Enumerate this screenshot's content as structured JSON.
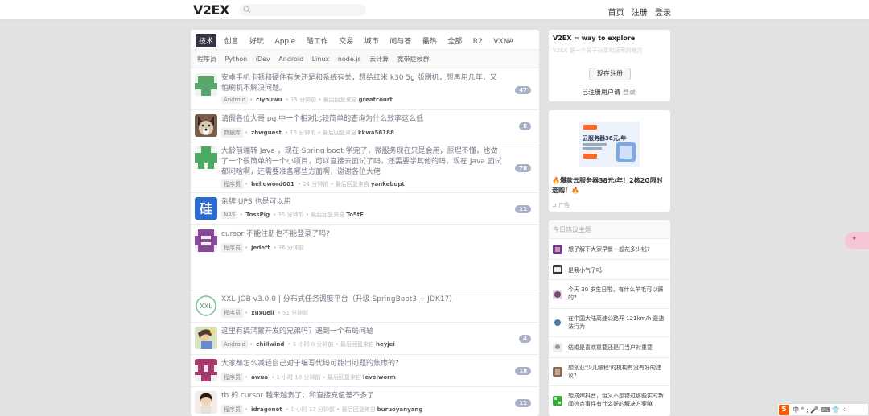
{
  "header": {
    "logo": "V2EX",
    "nav": [
      "首页",
      "注册",
      "登录"
    ]
  },
  "tabs": [
    "技术",
    "创意",
    "好玩",
    "Apple",
    "酷工作",
    "交易",
    "城市",
    "问与答",
    "最热",
    "全部",
    "R2",
    "VXNA"
  ],
  "active_tab": "技术",
  "subtabs": [
    "程序员",
    "Python",
    "iDev",
    "Android",
    "Linux",
    "node.js",
    "云计算",
    "宽带症候群"
  ],
  "topics": [
    {
      "title": "安卓手机卡顿和硬件有关还是和系统有关，想给红米 k30 5g 版刷机，想再用几年，又怕刷机不解决问题。",
      "node": "Android",
      "user": "ciyouwu",
      "time": "15 分钟前",
      "last_label": "最后回复来自",
      "last": "greatcourt",
      "count": "47"
    },
    {
      "title": "请假各位大哥 pg 中一个相对比较简单的查询为什么效率这么低",
      "node": "数据库",
      "user": "zhwguest",
      "time": "15 分钟前",
      "last_label": "最后回复来自",
      "last": "kkwa56188",
      "count": "6"
    },
    {
      "title": "大龄前端转 Java ，现在 Spring boot 学完了，微服务现在只是会用，原理不懂，也做了一个很简单的一个小项目，可以直接去面试了吗，还需要学其他的吗，现在 Java 面试都问啥啊，还需要准备哪些方面啊，谢谢各位大佬",
      "node": "程序员",
      "user": "helloword001",
      "time": "24 分钟前",
      "last_label": "最后回复来自",
      "last": "yankebupt",
      "count": "78"
    },
    {
      "title": "杂牌 UPS 也是可以用",
      "node": "NAS",
      "user": "TossPig",
      "time": "35 分钟前",
      "last_label": "最后回复来自",
      "last": "To5tE",
      "count": "11"
    },
    {
      "title": "cursor 不能注册也不能登录了吗?",
      "node": "程序员",
      "user": "jedeft",
      "time": "36 分钟前",
      "last_label": "",
      "last": "",
      "count": ""
    },
    {
      "title": "XXL-JOB v3.0.0 | 分布式任务调度平台（升级 SpringBoot3 + JDK17)",
      "node": "程序员",
      "user": "xuxueli",
      "time": "51 分钟前",
      "last_label": "",
      "last": "",
      "count": ""
    },
    {
      "title": "这里有搞鸿蒙开发的兄弟吗？遇到一个布局问题",
      "node": "Android",
      "user": "chillwind",
      "time": "1 小时 0 分钟前",
      "last_label": "最后回复来自",
      "last": "heyjei",
      "count": "4"
    },
    {
      "title": "大家都怎么减轻自己对于编写代码可能出问题的焦虑的?",
      "node": "程序员",
      "user": "awua",
      "time": "1 小时 16 分钟前",
      "last_label": "最后回复来自",
      "last": "levelworm",
      "count": "18"
    },
    {
      "title": "tb 的 cursor 越来越贵了：和直接充值差不多了",
      "node": "程序员",
      "user": "idragonet",
      "time": "1 小时 17 分钟前",
      "last_label": "最后回复来自",
      "last": "buruoyanyang",
      "count": "11"
    }
  ],
  "sidebar": {
    "title": "V2EX = way to explore",
    "subtitle": "V2EX 是一个关于分享和探索的地方",
    "register": "现在注册",
    "login_prefix": "已注册用户请",
    "login": "登录"
  },
  "ad": {
    "text": "🔥爆款云服务器38元/年！2核2G限时选购！🔥",
    "footer": "⊿ 广告",
    "img_title": "云服务器38元/年"
  },
  "hot": {
    "title": "今日热议主题",
    "items": [
      "想了解下大家早餐一般花多少钱?",
      "是我小气了吗",
      "今天 30 岁生日啦，有什么羊毛可以薅的?",
      "在中国大陆高速公路开 121km/h 是违法行为",
      "结婚是喜欢重要还是门当户对重要",
      "想创业'少儿编程'的机构有没有好的建议?",
      "想成婶抖音，但又不想错过那些实时新闻热点事件有什么好的解决方案嘛"
    ]
  },
  "ime": {
    "text": "中 ° ; 🎤 ⌨ 👕 ⁘"
  }
}
